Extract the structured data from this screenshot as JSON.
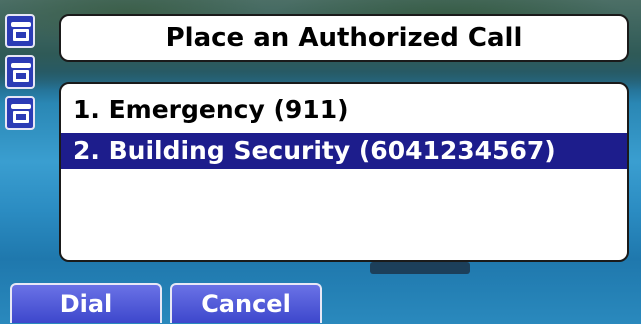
{
  "screen": {
    "title": "Place an Authorized Call"
  },
  "side_icons": [
    {
      "icon": "phone-handset-icon"
    },
    {
      "icon": "phone-handset-icon"
    },
    {
      "icon": "phone-handset-icon"
    }
  ],
  "calls": [
    {
      "label": "1. Emergency (911)",
      "selected": false
    },
    {
      "label": "2. Building Security (6041234567)",
      "selected": true
    }
  ],
  "softkeys": {
    "dial_label": "Dial",
    "cancel_label": "Cancel"
  },
  "colors": {
    "selection": "#1d1d8c",
    "softkey": "#4a54d6",
    "line_icon": "#2b3bb5"
  }
}
